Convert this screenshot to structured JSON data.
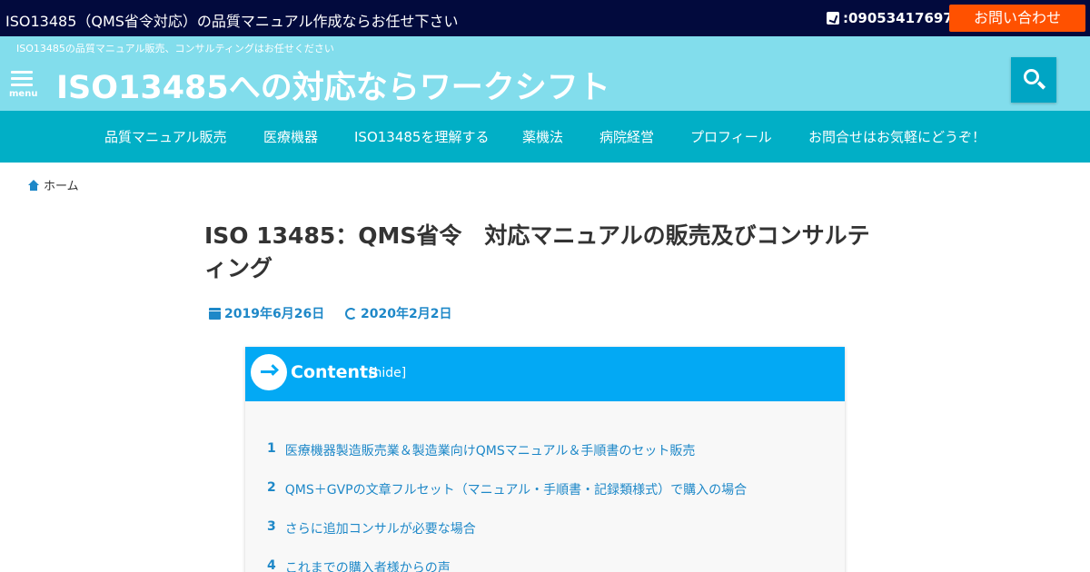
{
  "topbar": {
    "title": "ISO13485（QMS省令対応）の品質マニュアル作成ならお任せ下さい",
    "phone": ":09053417697",
    "contact_label": "お問い合わせ"
  },
  "header": {
    "tagline": "ISO13485の品質マニュアル販売、コンサルティングはお任せください",
    "menu_label": "menu",
    "site_title": "ISO13485への対応ならワークシフト"
  },
  "nav": {
    "items": [
      {
        "label": "品質マニュアル販売"
      },
      {
        "label": "医療機器"
      },
      {
        "label": "ISO13485を理解する"
      },
      {
        "label": "薬機法"
      },
      {
        "label": "病院経営"
      },
      {
        "label": "プロフィール"
      },
      {
        "label": "お問合せはお気軽にどうぞ！"
      }
    ]
  },
  "breadcrumb": {
    "home_label": "ホーム"
  },
  "post": {
    "title": "ISO 13485：QMS省令　対応マニュアルの販売及びコンサルティング",
    "published": "2019年6月26日",
    "updated": "2020年2月2日"
  },
  "toc": {
    "title": "Contents",
    "hide_label": "[hide]",
    "items": [
      {
        "num": "1",
        "label": "医療機器製造販売業＆製造業向けQMSマニュアル＆手順書のセット販売"
      },
      {
        "num": "2",
        "label": "QMS＋GVPの文章フルセット（マニュアル・手順書・記録類様式）で購入の場合"
      },
      {
        "num": "3",
        "label": "さらに追加コンサルが必要な場合"
      },
      {
        "num": "4",
        "label": "これまでの購入者様からの声"
      }
    ]
  },
  "colors": {
    "topbar_bg": "#020a3d",
    "header_bg": "#82ddec",
    "nav_bg": "#01afc6",
    "contact_bg": "#ff5100",
    "toc_header_bg": "#03a9f4",
    "link": "#1e88c8"
  },
  "icons": {
    "phone": "phone-icon",
    "menu": "hamburger-menu-icon",
    "search": "search-icon",
    "home": "home-icon",
    "calendar": "calendar-icon",
    "refresh": "refresh-icon",
    "toc_arrow": "arrow-right-circle-icon"
  }
}
